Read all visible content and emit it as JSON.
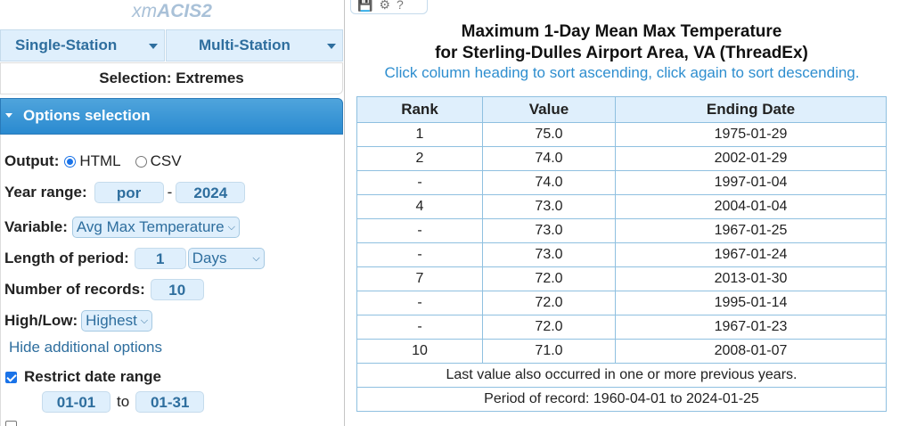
{
  "app": {
    "title_prefix": "xm",
    "title_main": "ACIS2"
  },
  "nav": {
    "single_station": "Single-Station",
    "multi_station": "Multi-Station"
  },
  "selection": "Selection: Extremes",
  "options": {
    "header": "Options selection",
    "output_label": "Output:",
    "output_html": "HTML",
    "output_csv": "CSV",
    "output_selected": "HTML",
    "year_range_label": "Year range:",
    "year_start": "por",
    "year_dash": "-",
    "year_end": "2024",
    "variable_label": "Variable:",
    "variable_value": "Avg Max Temperature",
    "length_label": "Length of period:",
    "length_value": "1",
    "length_unit": "Days",
    "records_label": "Number of records:",
    "records_value": "10",
    "highlow_label": "High/Low:",
    "highlow_value": "Highest",
    "hide_link": "Hide additional options",
    "restrict_label": "Restrict date range",
    "restrict_checked": true,
    "date_from": "01-01",
    "date_to_word": "to",
    "date_to": "01-31"
  },
  "toolbar": {
    "icons": [
      "save-icon",
      "gear-icon",
      "help-icon"
    ],
    "help_glyph": "?"
  },
  "report": {
    "title_line1": "Maximum 1-Day Mean Max Temperature",
    "title_line2": "for Sterling-Dulles Airport Area, VA (ThreadEx)",
    "sort_hint": "Click column heading to sort ascending, click again to sort descending.",
    "columns": [
      "Rank",
      "Value",
      "Ending Date"
    ],
    "rows": [
      [
        "1",
        "75.0",
        "1975-01-29"
      ],
      [
        "2",
        "74.0",
        "2002-01-29"
      ],
      [
        "-",
        "74.0",
        "1997-01-04"
      ],
      [
        "4",
        "73.0",
        "2004-01-04"
      ],
      [
        "-",
        "73.0",
        "1967-01-25"
      ],
      [
        "-",
        "73.0",
        "1967-01-24"
      ],
      [
        "7",
        "72.0",
        "2013-01-30"
      ],
      [
        "-",
        "72.0",
        "1995-01-14"
      ],
      [
        "-",
        "72.0",
        "1967-01-23"
      ],
      [
        "10",
        "71.0",
        "2008-01-07"
      ]
    ],
    "note": "Last value also occurred in one or more previous years.",
    "period": "Period of record: 1960-04-01 to 2024-01-25"
  },
  "colors": {
    "accent": "#2a8ad0",
    "button_bg": "#dfeffc",
    "button_text": "#2e6e9e",
    "link": "#2e8ecf"
  }
}
